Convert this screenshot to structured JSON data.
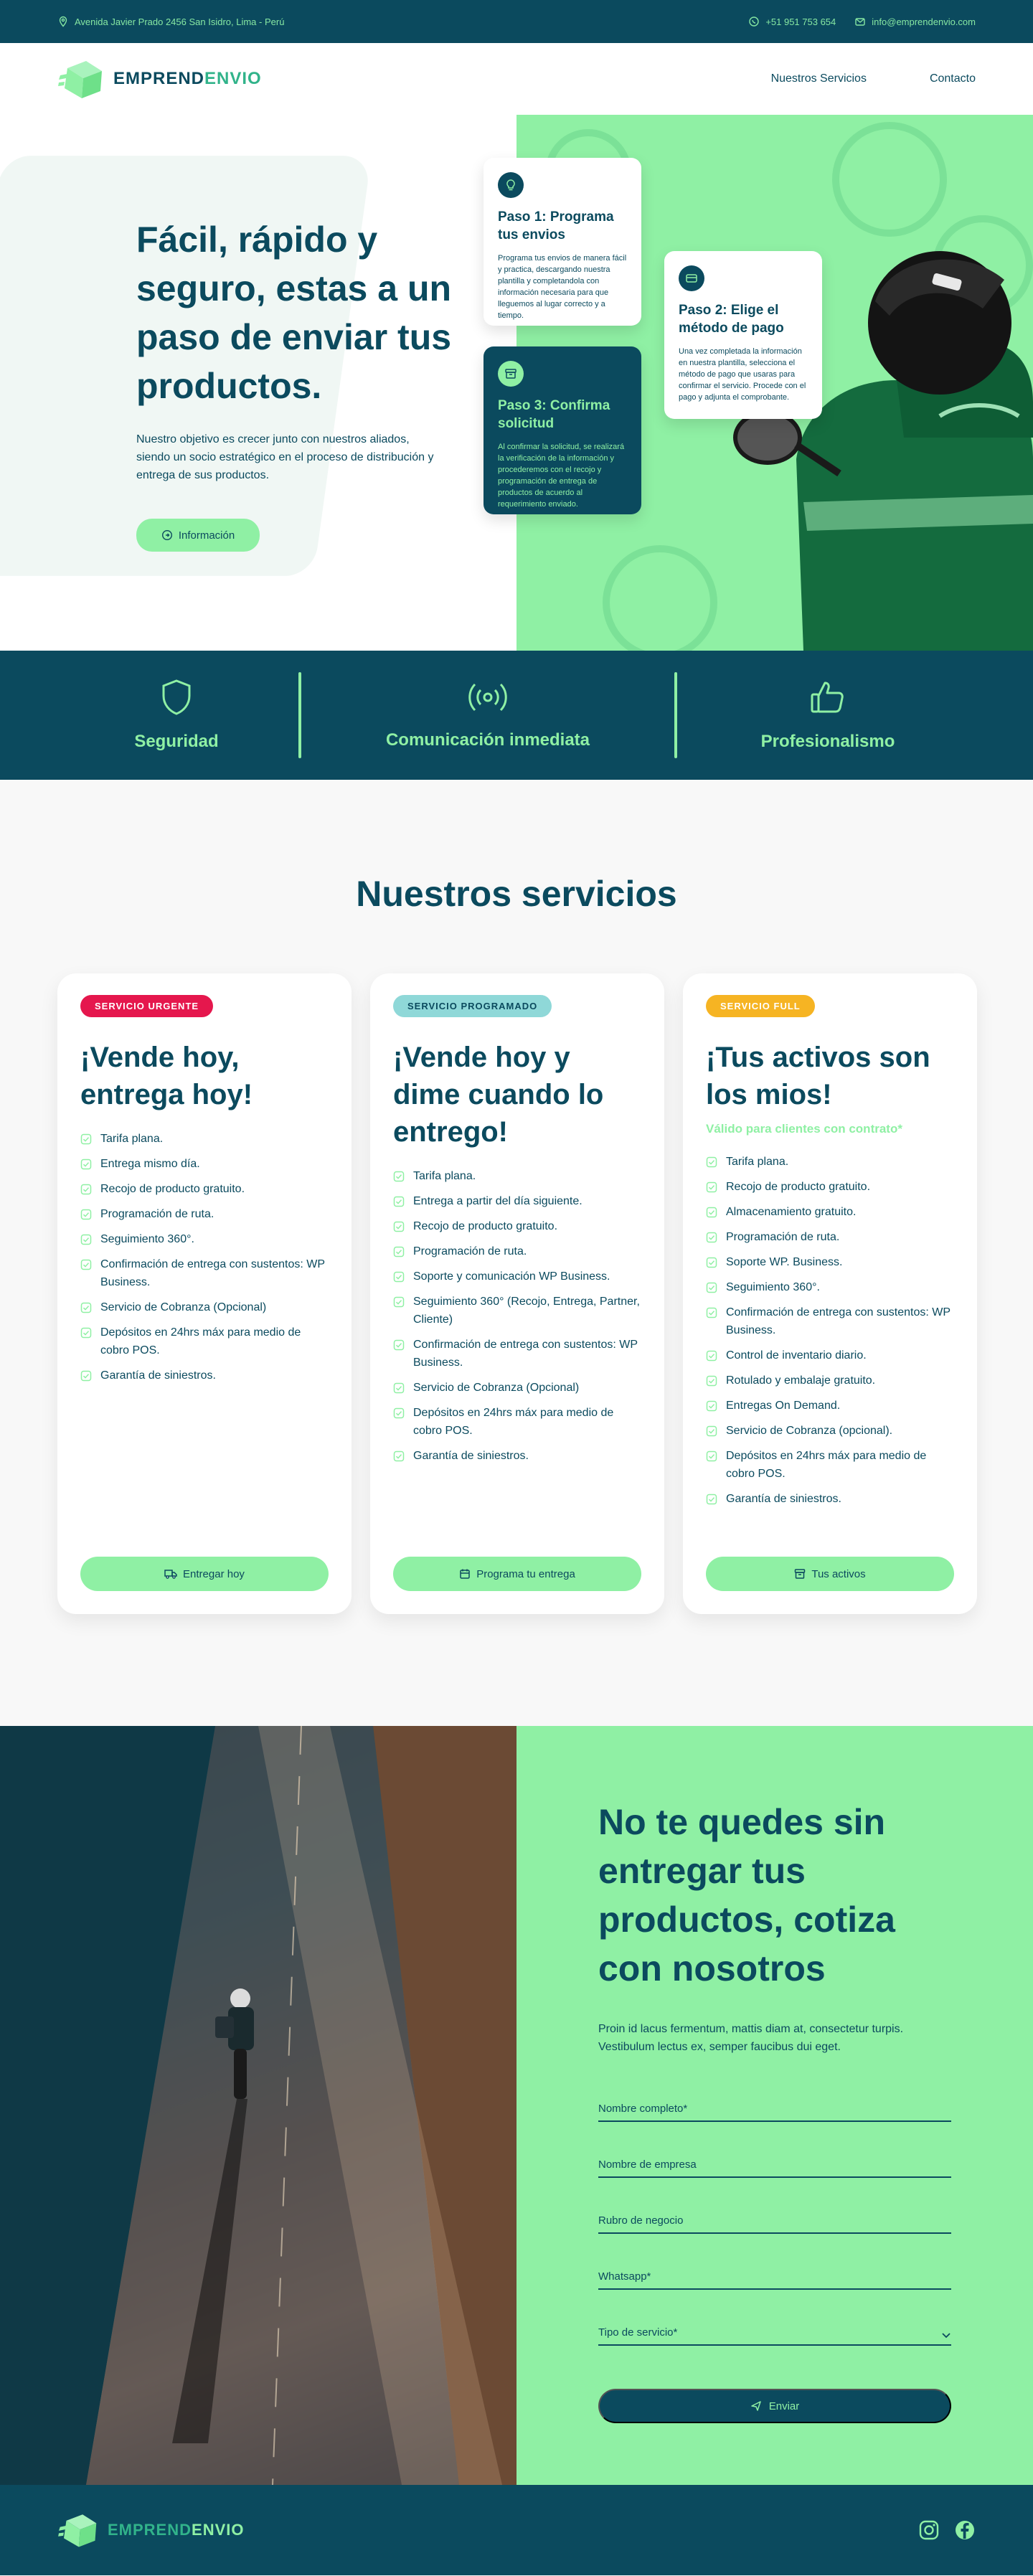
{
  "topbar": {
    "address": "Avenida Javier Prado 2456 San Isidro, Lima - Perú",
    "phone": "+51 951 753 654",
    "email": "info@emprendenvio.com"
  },
  "brand": {
    "name_a": "EMPREND",
    "name_b": "ENVIO"
  },
  "nav": {
    "services": "Nuestros Servicios",
    "contact": "Contacto"
  },
  "hero": {
    "title": "Fácil, rápido y seguro, estas a un paso de enviar tus productos.",
    "subtitle": "Nuestro objetivo es crecer junto con nuestros aliados, siendo un socio estratégico en el proceso de distribución y entrega de sus productos.",
    "button": "Información",
    "steps": [
      {
        "title": "Paso 1: Programa tus envios",
        "text": "Programa tus envios de manera fácil y practica, descargando nuestra plantilla y completandola con información necesaria para que lleguemos al lugar correcto y a tiempo."
      },
      {
        "title": "Paso 2: Elige el método de pago",
        "text": "Una vez completada la información en nuestra plantilla, selecciona el método de pago que usaras para confirmar el servicio. Procede con el pago y adjunta el comprobante."
      },
      {
        "title": "Paso 3: Confirma solicitud",
        "text": "Al confirmar la solicitud, se realizará la verificación de la información y procederemos con el recojo y programación de entrega de productos de acuerdo al requerimiento enviado."
      }
    ]
  },
  "features": [
    {
      "label": "Seguridad",
      "icon": "shield-icon"
    },
    {
      "label": "Comunicación inmediata",
      "icon": "broadcast-icon"
    },
    {
      "label": "Profesionalismo",
      "icon": "thumbs-up-icon"
    }
  ],
  "services": {
    "heading": "Nuestros servicios",
    "cards": [
      {
        "badge": "SERVICIO URGENTE",
        "badge_color": "#e5174d",
        "badge_text_color": "#ffffff",
        "title": "¡Vende hoy, entrega hoy!",
        "note": "",
        "items": [
          "Tarifa plana.",
          "Entrega mismo día.",
          "Recojo de producto gratuito.",
          "Programación de ruta.",
          "Seguimiento 360°.",
          "Confirmación de entrega con sustentos: WP Business.",
          "Servicio de Cobranza (Opcional)",
          "Depósitos en 24hrs máx para medio de cobro POS.",
          "Garantía de siniestros."
        ],
        "button": "Entregar hoy",
        "button_icon": "truck-icon"
      },
      {
        "badge": "SERVICIO PROGRAMADO",
        "badge_color": "#8fd8d8",
        "badge_text_color": "#0b4a5e",
        "title": "¡Vende hoy y dime cuando lo entrego!",
        "note": "",
        "items": [
          "Tarifa plana.",
          "Entrega a partir del día siguiente.",
          "Recojo de producto gratuito.",
          "Programación de ruta.",
          "Soporte y comunicación WP Business.",
          "Seguimiento 360° (Recojo, Entrega, Partner, Cliente)",
          "Confirmación de entrega con sustentos: WP Business.",
          "Servicio de Cobranza (Opcional)",
          "Depósitos en 24hrs máx para medio de cobro POS.",
          "Garantía de siniestros."
        ],
        "button": "Programa tu entrega",
        "button_icon": "calendar-icon"
      },
      {
        "badge": "SERVICIO FULL",
        "badge_color": "#f6b423",
        "badge_text_color": "#ffffff",
        "title": "¡Tus activos son los mios!",
        "note": "Válido para clientes con contrato*",
        "items": [
          "Tarifa plana.",
          "Recojo de producto gratuito.",
          "Almacenamiento gratuito.",
          "Programación de ruta.",
          "Soporte WP. Business.",
          "Seguimiento 360°.",
          "Confirmación de entrega con sustentos: WP Business.",
          "Control de inventario diario.",
          "Rotulado y embalaje gratuito.",
          "Entregas On Demand.",
          "Servicio de Cobranza (opcional).",
          "Depósitos en 24hrs máx para medio de cobro POS.",
          "Garantía de siniestros."
        ],
        "button": "Tus activos",
        "button_icon": "archive-icon"
      }
    ]
  },
  "contact": {
    "title": "No te quedes sin entregar tus productos, cotiza con nosotros",
    "lead": "Proin id lacus fermentum, mattis diam at, consectetur turpis. Vestibulum lectus ex, semper faucibus dui eget.",
    "fields": {
      "name": "Nombre completo*",
      "company": "Nombre de empresa",
      "business": "Rubro de negocio",
      "whatsapp": "Whatsapp*",
      "service_type": "Tipo de servicio*"
    },
    "submit": "Enviar"
  },
  "colors": {
    "primary": "#0b4a5e",
    "accent": "#8ff0a4"
  }
}
